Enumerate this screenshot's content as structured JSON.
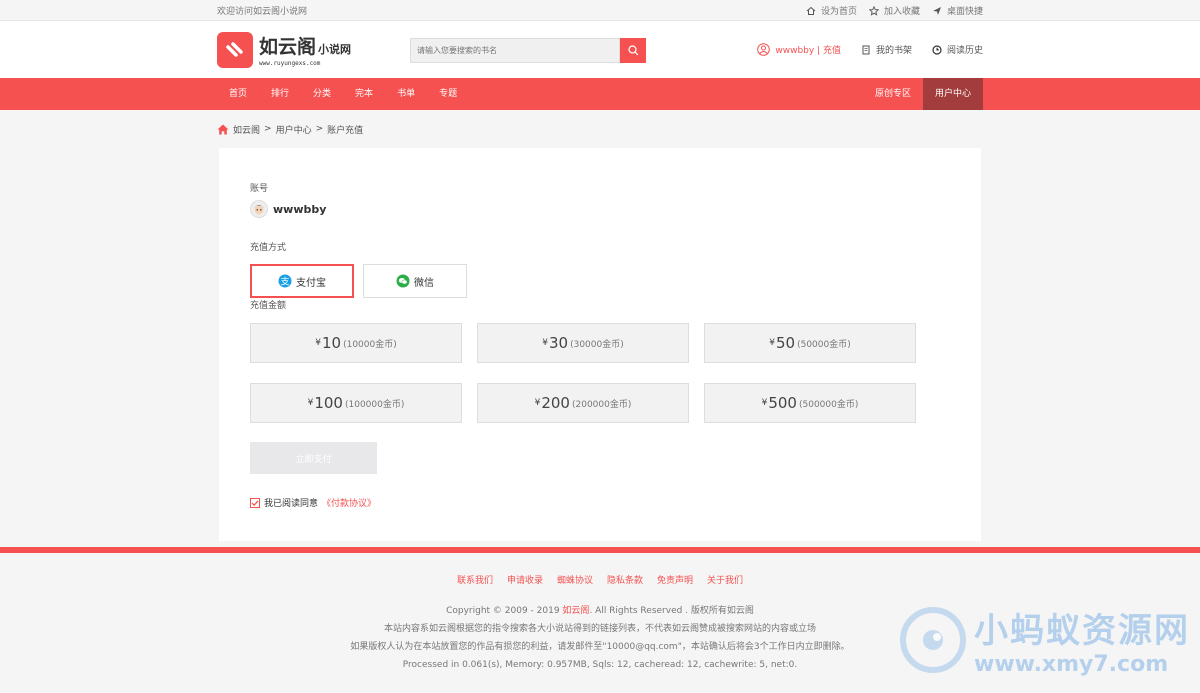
{
  "topbar": {
    "welcome": "欢迎访问如云阁小说网",
    "set_home": "设为首页",
    "add_fav": "加入收藏",
    "desktop": "桌面快捷"
  },
  "header": {
    "logo_big": "如云阁",
    "logo_small": "小说网",
    "logo_url": "www.ruyungexs.com",
    "search_placeholder": "请输入您要搜索的书名",
    "user_link": "wwwbby | 充值",
    "bookshelf": "我的书架",
    "history": "阅读历史"
  },
  "nav": {
    "items": [
      "首页",
      "排行",
      "分类",
      "完本",
      "书单",
      "专题"
    ],
    "right_items": [
      "原创专区",
      "用户中心"
    ],
    "active": "用户中心"
  },
  "breadcrumb": {
    "home": "如云阁",
    "sep": ">",
    "level1": "用户中心",
    "level2": "账户充值"
  },
  "panel": {
    "account_label": "账号",
    "account_name": "wwwbby",
    "method_label": "充值方式",
    "methods": [
      {
        "label": "支付宝",
        "icon": "alipay-icon",
        "selected": true
      },
      {
        "label": "微信",
        "icon": "wechat-icon",
        "selected": false
      }
    ],
    "amount_label": "充值金额",
    "currency": "¥",
    "amounts": [
      {
        "value": "10",
        "coins": "(10000金币)"
      },
      {
        "value": "30",
        "coins": "(30000金币)"
      },
      {
        "value": "50",
        "coins": "(50000金币)"
      },
      {
        "value": "100",
        "coins": "(100000金币)"
      },
      {
        "value": "200",
        "coins": "(200000金币)"
      },
      {
        "value": "500",
        "coins": "(500000金币)"
      }
    ],
    "pay_now": "立即支付",
    "agree_text": "我已阅读同意",
    "agree_link": "《付款协议》"
  },
  "footer": {
    "links": [
      "联系我们",
      "申请收录",
      "蜘蛛协议",
      "隐私条款",
      "免责声明",
      "关于我们"
    ],
    "copyright_pre": "Copyright © 2009 - 2019 ",
    "copyright_site": "如云阁",
    "copyright_post": ". All Rights Reserved . 版权所有如云阁",
    "line2": "本站内容系如云阁根据您的指令搜索各大小说站得到的链接列表，不代表如云阁赞成被搜索网站的内容或立场",
    "line3": "如果版权人认为在本站放置您的作品有损您的利益，请发邮件至\"10000@qq.com\"，本站确认后将会3个工作日内立即删除。",
    "line4": "Processed in 0.061(s), Memory: 0.957MB, Sqls: 12, cacheread: 12, cachewrite: 5, net:0."
  },
  "watermark": {
    "cn": "小蚂蚁资源网",
    "url": "www.xmy7.com"
  },
  "colors": {
    "brand": "#f55151",
    "nav_active": "#a33c3c"
  }
}
